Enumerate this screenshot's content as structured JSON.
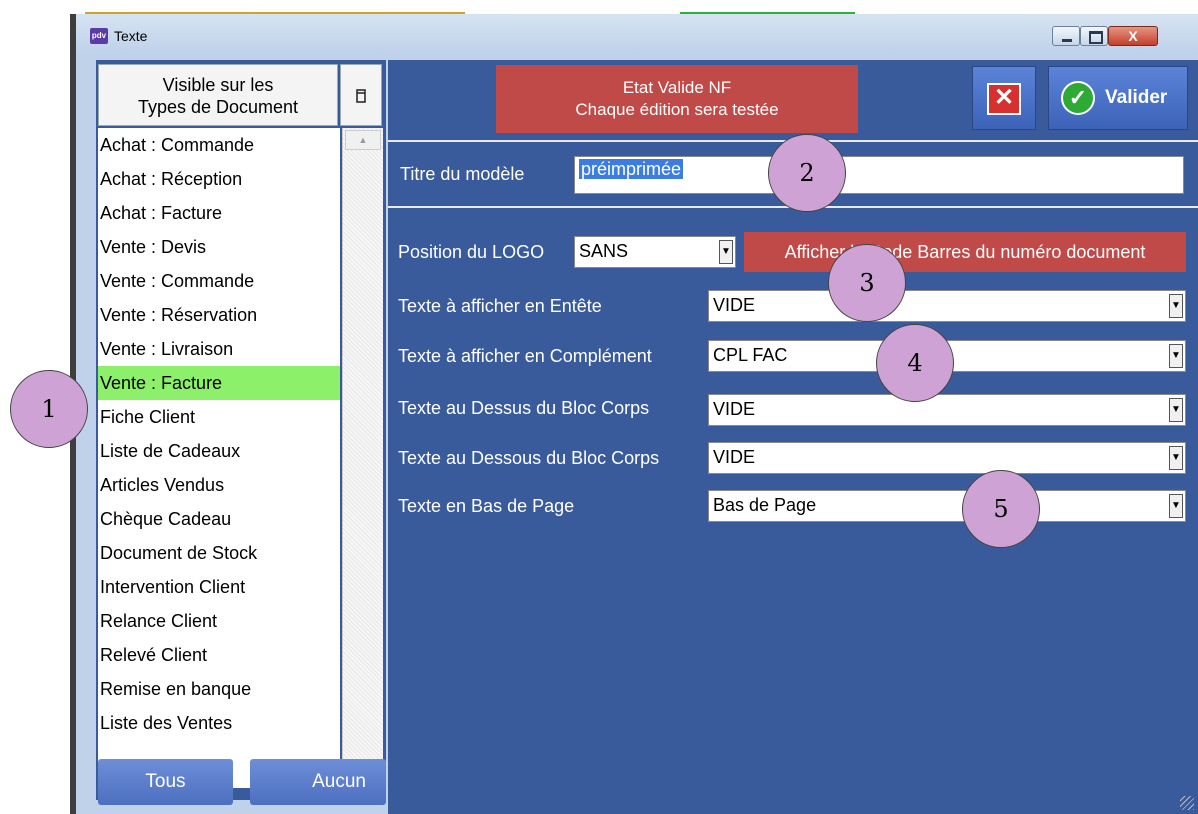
{
  "window": {
    "title": "Texte",
    "app_icon_label": "pdv",
    "close_glyph": "X"
  },
  "left_panel": {
    "header_line1": "Visible sur les",
    "header_line2": "Types de Document",
    "items": [
      "Achat : Commande",
      "Achat : Réception",
      "Achat : Facture",
      "Vente : Devis",
      "Vente : Commande",
      "Vente : Réservation",
      "Vente : Livraison",
      "Vente : Facture",
      "Fiche Client",
      "Liste de Cadeaux",
      "Articles Vendus",
      "Chèque Cadeau",
      "Document de Stock",
      "Intervention Client",
      "Relance Client",
      "Relevé Client",
      "Remise en banque",
      "Liste des Ventes"
    ],
    "selected_index": 7,
    "tous_label": "Tous",
    "aucun_label": "Aucun"
  },
  "status": {
    "line1": "Etat Valide NF",
    "line2": "Chaque édition sera testée"
  },
  "actions": {
    "valider_label": "Valider"
  },
  "form": {
    "titre_label": "Titre du modèle",
    "titre_value": "préimprimée",
    "logo_label": "Position du LOGO",
    "logo_value": "SANS",
    "barcode_label": "Afficher le Code Barres du numéro document",
    "entete_label": "Texte à afficher en Entête",
    "entete_value": "VIDE",
    "complement_label": "Texte à afficher en Complément",
    "complement_value": "CPL FAC",
    "dessus_label": "Texte au Dessus du Bloc Corps",
    "dessus_value": "VIDE",
    "dessous_label": "Texte au Dessous du Bloc Corps",
    "dessous_value": "VIDE",
    "bas_label": "Texte en Bas de Page",
    "bas_value": "Bas de Page"
  },
  "markers": [
    "1",
    "2",
    "3",
    "4",
    "5"
  ],
  "colors": {
    "panel_blue": "#3a5b9b",
    "status_red": "#c04a48",
    "selected_green": "#8cf06a",
    "marker_purple": "#cfa2d6"
  }
}
